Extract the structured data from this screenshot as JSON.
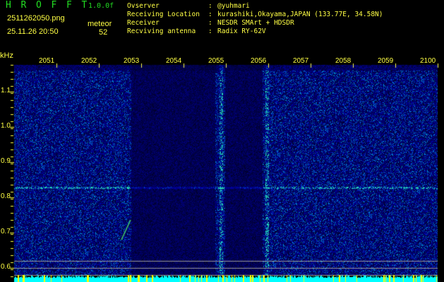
{
  "header": {
    "logo_letters": [
      "H",
      "R",
      "O",
      "F",
      "F",
      "T"
    ],
    "version": "1.0.0f",
    "filename": "2511262050.png",
    "datetime": "25.11.26 20:50",
    "meteor_label": "meteor",
    "meteor_count": "52"
  },
  "info": [
    {
      "label": "Ovserver",
      "value": "@yuhmari"
    },
    {
      "label": "Receiving Location",
      "value": "kurashiki,Okayama,JAPAN (133.77E, 34.58N)"
    },
    {
      "label": "Receiver",
      "value": "NESDR SMArt + HDSDR"
    },
    {
      "label": "Recviving antenna",
      "value": "Radix RY-62V"
    }
  ],
  "spectrogram": {
    "freq_unit": "kHz",
    "freq_ticks": [
      "1.1",
      "1.0",
      "0.9",
      "0.8",
      "0.7",
      "0.6"
    ],
    "freq_values": [
      1.1,
      1.0,
      0.9,
      0.8,
      0.7,
      0.6
    ],
    "freq_range_khz": [
      0.55,
      1.2
    ],
    "time_ticks": [
      "2051",
      "2052",
      "2053",
      "2054",
      "2055",
      "2056",
      "2057",
      "2058",
      "2059",
      "2100"
    ],
    "colors": {
      "background": "#000000",
      "label": "#ffff44",
      "title": "#22dd22",
      "noise": "#1a2aa0",
      "meteor_bar": "#00ffff"
    }
  }
}
